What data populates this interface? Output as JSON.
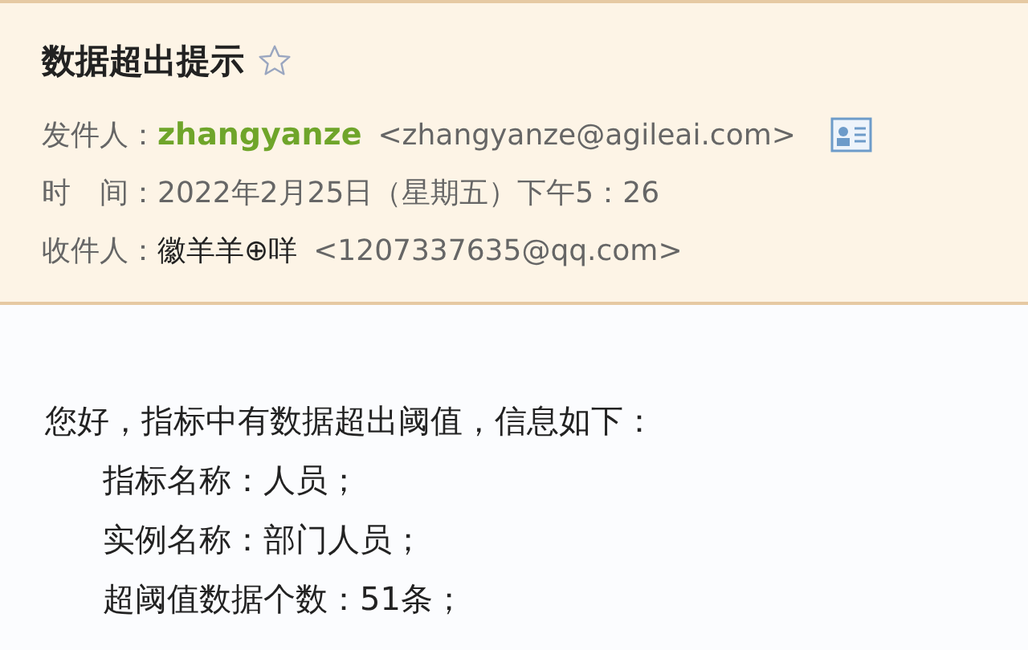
{
  "subject": "数据超出提示",
  "starred": false,
  "fields": [
    {
      "label": "发件人：",
      "name": "zhangyanze",
      "address": "<zhangyanze@agileai.com>",
      "kind": "sender"
    },
    {
      "label": "时　间：",
      "value": "2022年2月25日（星期五）下午5：26",
      "kind": "time"
    },
    {
      "label": "收件人：",
      "name": "徽羊羊⊕咩",
      "address": "<1207337635@qq.com>",
      "kind": "recipient"
    }
  ],
  "body": {
    "greeting": "您好，指标中有数据超出阈值，信息如下：",
    "items": [
      "指标名称：人员；",
      "实例名称：部门人员；",
      "超阈值数据个数：51条；"
    ]
  }
}
